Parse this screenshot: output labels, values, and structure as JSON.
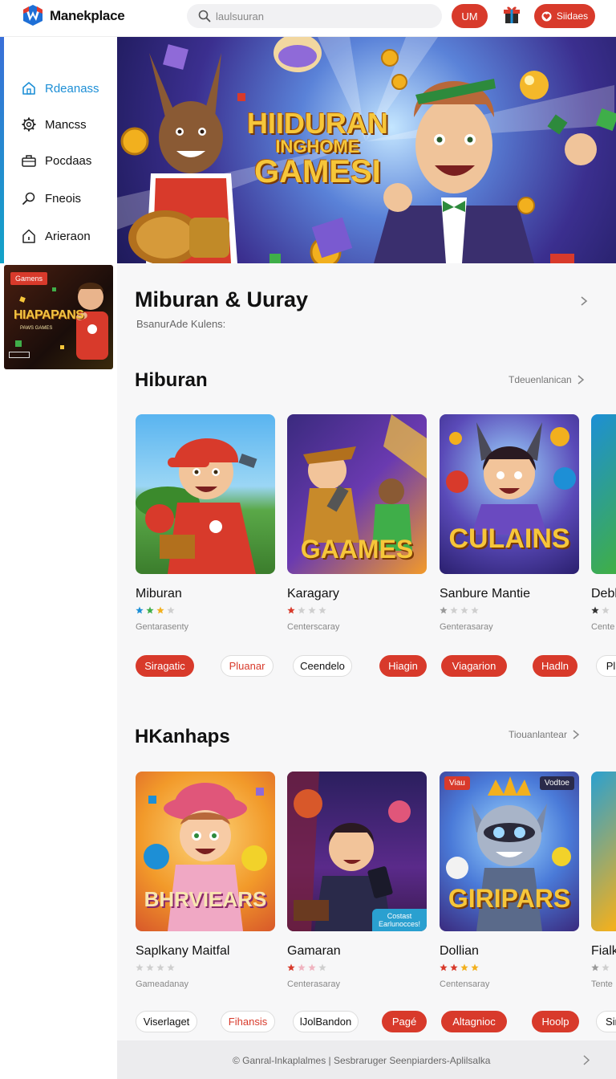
{
  "header": {
    "brand": "Manekplace",
    "search_placeholder": "laulsuuran",
    "um_label": "UM",
    "sign_label": "Siidaes"
  },
  "sidebar": {
    "items": [
      {
        "label": "Rdeanass",
        "icon": "home-icon",
        "active": true
      },
      {
        "label": "Mancss",
        "icon": "gear-icon",
        "active": false
      },
      {
        "label": "Pocdaas",
        "icon": "briefcase-icon",
        "active": false
      },
      {
        "label": "Fneois",
        "icon": "magnifier-icon",
        "active": false
      },
      {
        "label": "Arieraon",
        "icon": "house-icon",
        "active": false
      }
    ],
    "promo": {
      "tag": "Gamens",
      "title": "HIAPAPANS",
      "subtitle": "PAWS GAMES"
    }
  },
  "hero": {
    "title_line1": "HIIDURAN",
    "title_line2": "INGHOME",
    "title_line3": "GAMESI"
  },
  "promo_section": {
    "title": "Miburan & Uuray",
    "subtitle": "BsanurAde Kulens:"
  },
  "sections": [
    {
      "title": "Hiburan",
      "link": "Tdeuenlanican",
      "cards": [
        {
          "name": "Miburan",
          "category": "Gentarasenty",
          "image_title": "",
          "stars": [
            "#1d8fd6",
            "#3fae49",
            "#f2b01e",
            "#cfcfcf"
          ]
        },
        {
          "name": "Karagary",
          "category": "Centerscaray",
          "image_title": "GAAMES",
          "stars": [
            "#d83a2b",
            "#cfcfcf",
            "#cfcfcf",
            "#cfcfcf"
          ]
        },
        {
          "name": "Sanbure Mantie",
          "category": "Genterasaray",
          "image_title": "CULAINS",
          "stars": [
            "#9a9a9a",
            "#cfcfcf",
            "#cfcfcf",
            "#cfcfcf"
          ]
        },
        {
          "name": "Debl",
          "category": "Cente",
          "image_title": "",
          "stars": [
            "#333333",
            "#cfcfcf"
          ]
        }
      ],
      "pills": [
        {
          "label": "Siragatic",
          "style": "red"
        },
        {
          "label": "Pluanar",
          "style": "outline-red"
        },
        {
          "label": "Ceendelo",
          "style": "outline"
        },
        {
          "label": "Hiagin",
          "style": "red"
        },
        {
          "label": "Viagarion",
          "style": "red"
        },
        {
          "label": "Hadln",
          "style": "red"
        },
        {
          "label": "Pll",
          "style": "outline"
        }
      ]
    },
    {
      "title": "HKanhaps",
      "link": "Tiouanlantear",
      "cards": [
        {
          "name": "Saplkany Maitfal",
          "category": "Gameadanay",
          "image_title": "BHRVIEARS",
          "stars": [
            "#cfcfcf",
            "#cfcfcf",
            "#cfcfcf",
            "#cfcfcf"
          ]
        },
        {
          "name": "Gamaran",
          "category": "Centerasaray",
          "image_title": "",
          "badge": "Costast Earlunocces!",
          "stars": [
            "#d83a2b",
            "#f0b4c0",
            "#f0b4c0",
            "#cfcfcf"
          ]
        },
        {
          "name": "Dollian",
          "category": "Centensaray",
          "image_title": "GIRIPARS",
          "badge_left": "Viau",
          "badge_right": "Vodtoe",
          "stars": [
            "#d83a2b",
            "#d83a2b",
            "#f2b01e",
            "#f2b01e"
          ]
        },
        {
          "name": "Fialk",
          "category": "Tente",
          "image_title": "",
          "stars": [
            "#9a9a9a",
            "#cfcfcf"
          ]
        }
      ],
      "pills": [
        {
          "label": "Viserlaget",
          "style": "outline"
        },
        {
          "label": "Fihansis",
          "style": "outline-red"
        },
        {
          "label": "lJolBandon",
          "style": "outline"
        },
        {
          "label": "Pagé",
          "style": "red"
        },
        {
          "label": "Altagnioc",
          "style": "red"
        },
        {
          "label": "Hoolp",
          "style": "red"
        },
        {
          "label": "Sir",
          "style": "outline"
        }
      ]
    }
  ],
  "footer": {
    "text": "© Ganral-Inkaplalmes  |  Sesbraruger Seenpiarders-Aplilsalka"
  },
  "colors": {
    "accent_red": "#d83a2b",
    "accent_blue": "#1d8fd6"
  }
}
